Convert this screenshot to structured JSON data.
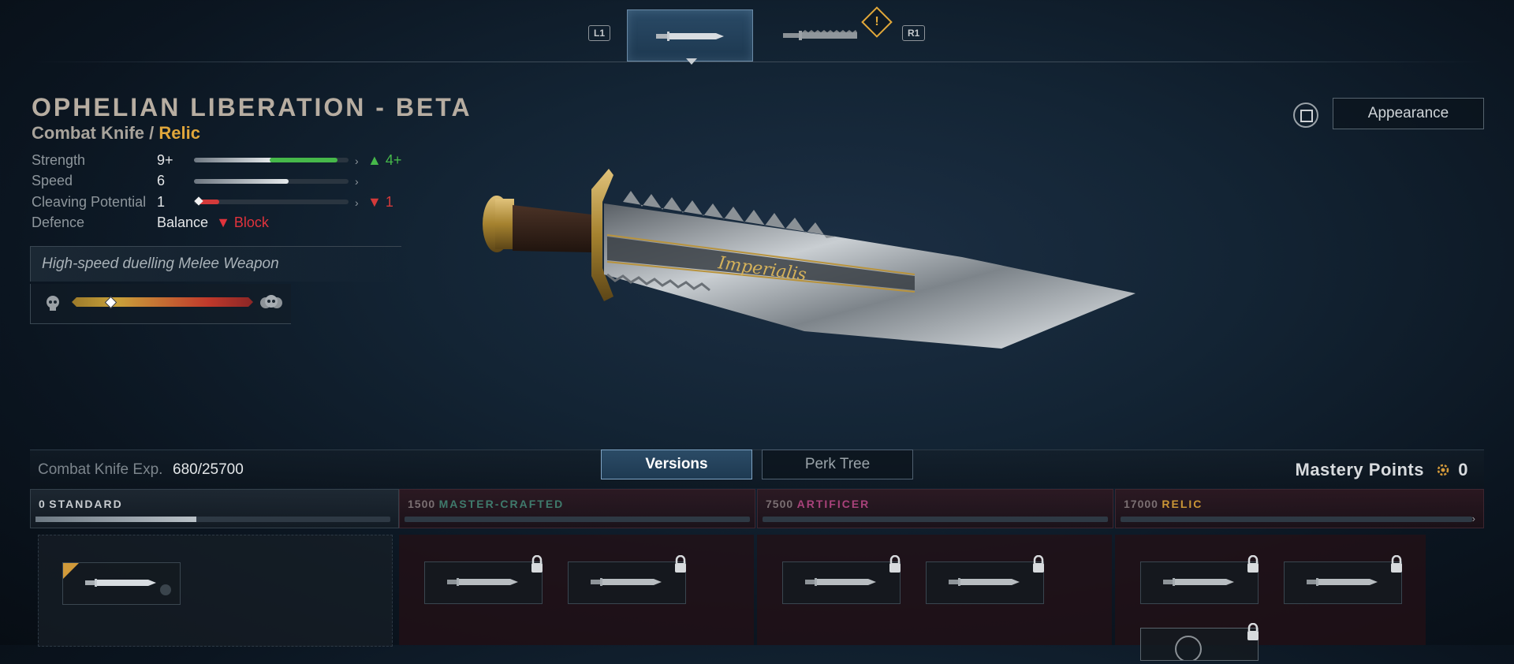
{
  "weapon_switcher": {
    "left_hint": "L1",
    "right_hint": "R1",
    "warning_symbol": "!",
    "slots": [
      {
        "name": "combat-knife",
        "active": true
      },
      {
        "name": "chainsword",
        "active": false,
        "warning": true
      }
    ]
  },
  "weapon": {
    "name": "OPHELIAN LIBERATION - BETA",
    "type": "Combat Knife",
    "separator": " / ",
    "rarity": "Relic",
    "engraving": "Imperialis"
  },
  "stats": [
    {
      "label": "Strength",
      "value": "9+",
      "level": 0.93,
      "delta": "▲ 4+"
    },
    {
      "label": "Speed",
      "value": "6",
      "level": 0.6,
      "delta": ""
    },
    {
      "label": "Cleaving Potential",
      "value": "1",
      "level": 0.18,
      "delta": "▼ 1"
    },
    {
      "label": "Defence",
      "value": "Balance",
      "secondary": "▼ Block"
    }
  ],
  "description": "High-speed duelling Melee Weapon",
  "difficulty": {
    "level": 0.2
  },
  "appearance_button": "Appearance",
  "experience": {
    "label": "Combat Knife Exp.",
    "value": "680/25700"
  },
  "tabs": {
    "versions": "Versions",
    "perk_tree": "Perk Tree"
  },
  "mastery": {
    "label": "Mastery Points",
    "value": "0"
  },
  "tiers": [
    {
      "num": "0",
      "name": "STANDARD",
      "color": "#c8ccd0",
      "progress": 0.45
    },
    {
      "num": "1500",
      "name": "MASTER-CRAFTED",
      "color": "#3f7a6c",
      "progress": 0
    },
    {
      "num": "7500",
      "name": "ARTIFICER",
      "color": "#a8427a",
      "progress": 0
    },
    {
      "num": "17000",
      "name": "RELIC",
      "color": "#c99536",
      "progress": 0
    }
  ],
  "colors": {
    "relic": "#e0a63b",
    "positive": "#46b84a",
    "negative": "#e0333c",
    "accent_tab": "#2b4b66"
  }
}
